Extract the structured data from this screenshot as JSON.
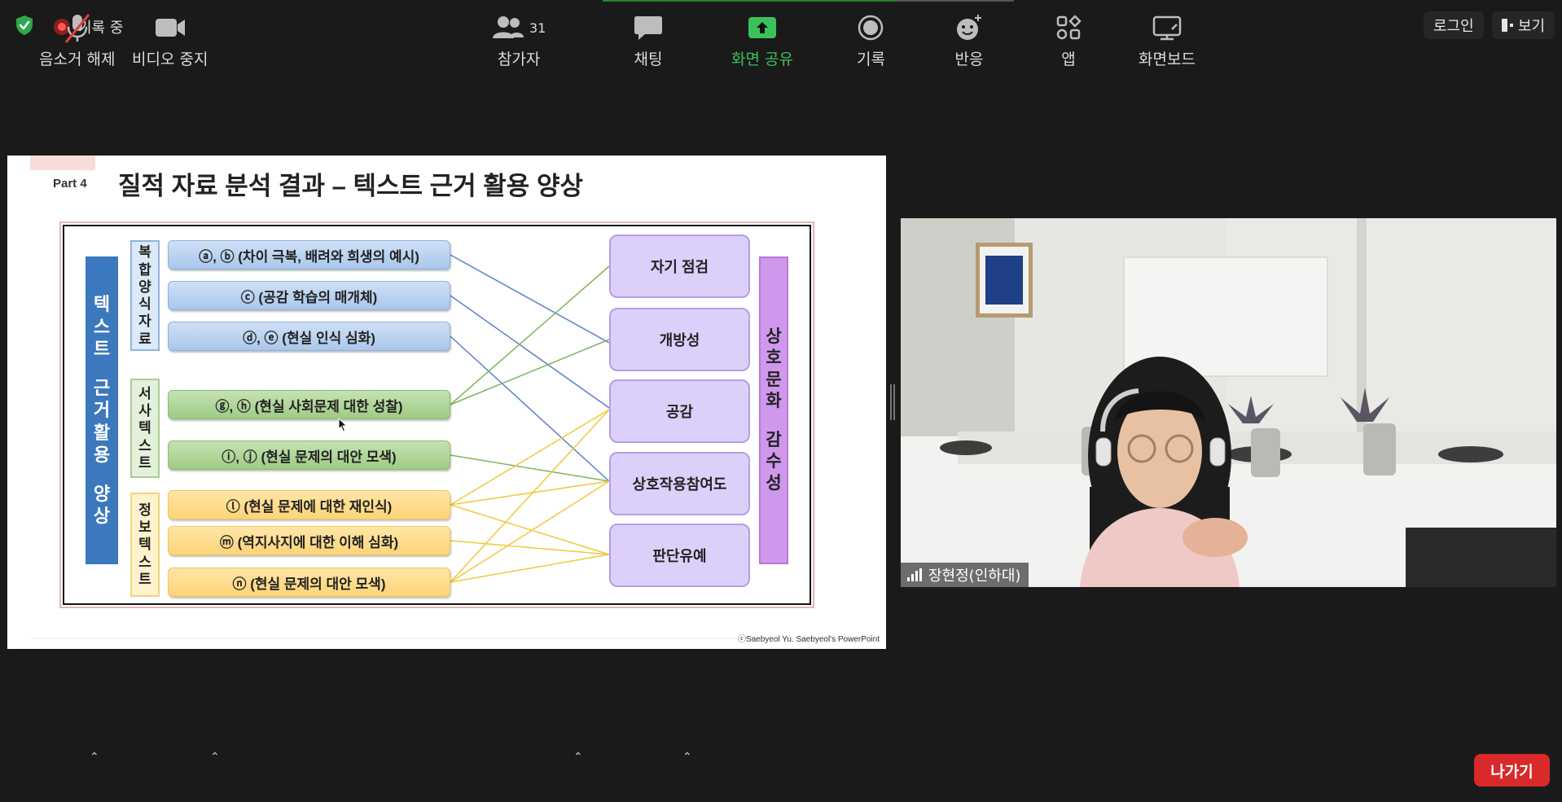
{
  "header": {
    "recording_label": "기록 중",
    "login_label": "로그인",
    "view_label": "보기"
  },
  "slide": {
    "part_label": "Part 4",
    "title": "질적 자료 분석 결과 – 텍스트 근거 활용 양상",
    "credit": "ⓒSaebyeol Yu. Saebyeol's PowerPoint",
    "main_label_a": [
      "텍",
      "스",
      "트"
    ],
    "main_label_b": [
      "근",
      "거",
      "활",
      "용"
    ],
    "main_label_c": [
      "양",
      "상"
    ],
    "group_blue": [
      "복",
      "합",
      "양",
      "식",
      "자",
      "료"
    ],
    "group_green": [
      "서",
      "사",
      "텍",
      "스",
      "트"
    ],
    "group_yellow": [
      "정",
      "보",
      "텍",
      "스",
      "트"
    ],
    "right_label_a": [
      "상",
      "호",
      "문",
      "화"
    ],
    "right_label_b": [
      "감",
      "수",
      "성"
    ],
    "pills": [
      "ⓐ, ⓑ (차이 극복, 배려와 희생의 예시)",
      "ⓒ (공감 학습의 매개체)",
      "ⓓ, ⓔ (현실 인식 심화)",
      "ⓖ, ⓗ (현실 사회문제 대한 성찰)",
      "ⓘ, ⓙ (현실 문제의 대안 모색)",
      "ⓛ (현실 문제에 대한 재인식)",
      "ⓜ (역지사지에 대한 이해 심화)",
      "ⓝ (현실 문제의 대안 모색)"
    ],
    "boxes": [
      "자기 점검",
      "개방성",
      "공감",
      "상호작용참여도",
      "판단유예"
    ]
  },
  "participant": {
    "name": "장현정(인하대)"
  },
  "toolbar": {
    "mute_label": "음소거 해제",
    "video_label": "비디오 중지",
    "participants_label": "참가자",
    "participants_count": "31",
    "chat_label": "채팅",
    "share_label": "화면 공유",
    "record_label": "기록",
    "reactions_label": "반응",
    "apps_label": "앱",
    "whiteboard_label": "화면보드",
    "leave_label": "나가기"
  },
  "colors": {
    "share_green": "#3cc15a",
    "leave_red": "#d9292b",
    "shield_green": "#2fa84f",
    "mute_slash": "#e0403a"
  }
}
